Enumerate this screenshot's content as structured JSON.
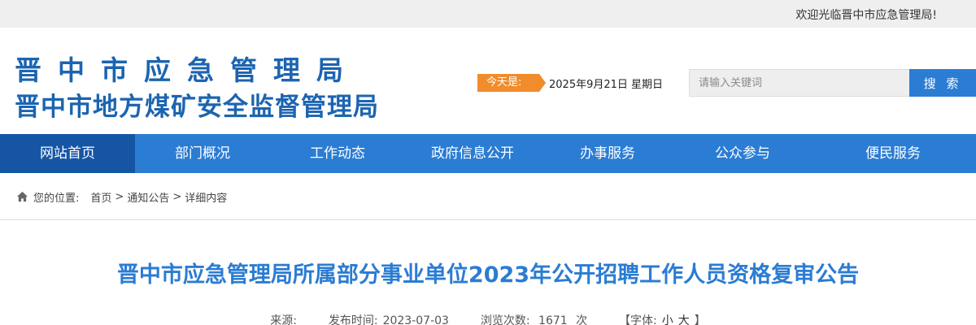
{
  "topbar": {
    "welcome": "欢迎光临晋中市应急管理局!"
  },
  "header": {
    "logo_line1": "晋中市应急管理局",
    "logo_line2": "晋中市地方煤矿安全监督管理局",
    "today_label": "今天是:",
    "date": "2025年9月21日 星期日",
    "search_placeholder": "请输入关键词",
    "search_button": "搜 索"
  },
  "nav": {
    "items": [
      {
        "label": "网站首页"
      },
      {
        "label": "部门概况"
      },
      {
        "label": "工作动态"
      },
      {
        "label": "政府信息公开"
      },
      {
        "label": "办事服务"
      },
      {
        "label": "公众参与"
      },
      {
        "label": "便民服务"
      }
    ],
    "active_index": 0
  },
  "breadcrumb": {
    "prefix": "您的位置:",
    "items": [
      "首页",
      "通知公告",
      "详细内容"
    ],
    "separator": ">"
  },
  "article": {
    "title": "晋中市应急管理局所属部分事业单位2023年公开招聘工作人员资格复审公告",
    "source_label": "来源:",
    "publish_label": "发布时间:",
    "publish_date": "2023-07-03",
    "views_label": "浏览次数:",
    "views": "1671",
    "views_unit": "次",
    "font_label": "【字体:",
    "font_small": "小",
    "font_large": "大",
    "font_close": "】"
  },
  "colors": {
    "primary_blue": "#2b7cd3",
    "nav_active": "#1555a4",
    "date_tag_orange": "#f08c2b",
    "topbar_bg": "#efefef"
  }
}
